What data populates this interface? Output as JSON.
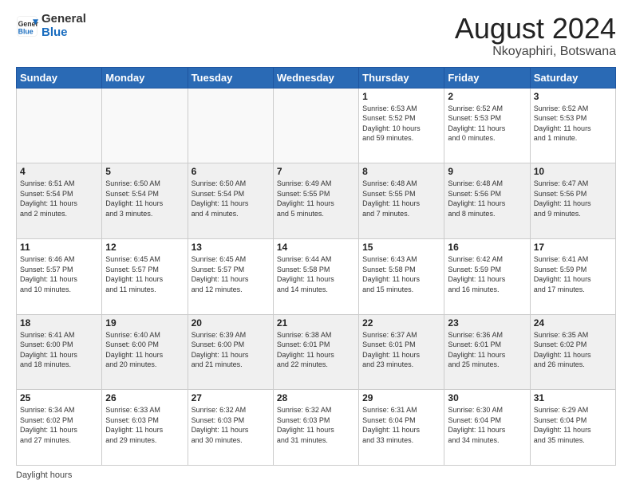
{
  "logo": {
    "general": "General",
    "blue": "Blue"
  },
  "header": {
    "title": "August 2024",
    "subtitle": "Nkoyaphiri, Botswana"
  },
  "weekdays": [
    "Sunday",
    "Monday",
    "Tuesday",
    "Wednesday",
    "Thursday",
    "Friday",
    "Saturday"
  ],
  "footer": {
    "daylight_label": "Daylight hours"
  },
  "weeks": [
    [
      {
        "day": "",
        "info": ""
      },
      {
        "day": "",
        "info": ""
      },
      {
        "day": "",
        "info": ""
      },
      {
        "day": "",
        "info": ""
      },
      {
        "day": "1",
        "info": "Sunrise: 6:53 AM\nSunset: 5:52 PM\nDaylight: 10 hours\nand 59 minutes."
      },
      {
        "day": "2",
        "info": "Sunrise: 6:52 AM\nSunset: 5:53 PM\nDaylight: 11 hours\nand 0 minutes."
      },
      {
        "day": "3",
        "info": "Sunrise: 6:52 AM\nSunset: 5:53 PM\nDaylight: 11 hours\nand 1 minute."
      }
    ],
    [
      {
        "day": "4",
        "info": "Sunrise: 6:51 AM\nSunset: 5:54 PM\nDaylight: 11 hours\nand 2 minutes."
      },
      {
        "day": "5",
        "info": "Sunrise: 6:50 AM\nSunset: 5:54 PM\nDaylight: 11 hours\nand 3 minutes."
      },
      {
        "day": "6",
        "info": "Sunrise: 6:50 AM\nSunset: 5:54 PM\nDaylight: 11 hours\nand 4 minutes."
      },
      {
        "day": "7",
        "info": "Sunrise: 6:49 AM\nSunset: 5:55 PM\nDaylight: 11 hours\nand 5 minutes."
      },
      {
        "day": "8",
        "info": "Sunrise: 6:48 AM\nSunset: 5:55 PM\nDaylight: 11 hours\nand 7 minutes."
      },
      {
        "day": "9",
        "info": "Sunrise: 6:48 AM\nSunset: 5:56 PM\nDaylight: 11 hours\nand 8 minutes."
      },
      {
        "day": "10",
        "info": "Sunrise: 6:47 AM\nSunset: 5:56 PM\nDaylight: 11 hours\nand 9 minutes."
      }
    ],
    [
      {
        "day": "11",
        "info": "Sunrise: 6:46 AM\nSunset: 5:57 PM\nDaylight: 11 hours\nand 10 minutes."
      },
      {
        "day": "12",
        "info": "Sunrise: 6:45 AM\nSunset: 5:57 PM\nDaylight: 11 hours\nand 11 minutes."
      },
      {
        "day": "13",
        "info": "Sunrise: 6:45 AM\nSunset: 5:57 PM\nDaylight: 11 hours\nand 12 minutes."
      },
      {
        "day": "14",
        "info": "Sunrise: 6:44 AM\nSunset: 5:58 PM\nDaylight: 11 hours\nand 14 minutes."
      },
      {
        "day": "15",
        "info": "Sunrise: 6:43 AM\nSunset: 5:58 PM\nDaylight: 11 hours\nand 15 minutes."
      },
      {
        "day": "16",
        "info": "Sunrise: 6:42 AM\nSunset: 5:59 PM\nDaylight: 11 hours\nand 16 minutes."
      },
      {
        "day": "17",
        "info": "Sunrise: 6:41 AM\nSunset: 5:59 PM\nDaylight: 11 hours\nand 17 minutes."
      }
    ],
    [
      {
        "day": "18",
        "info": "Sunrise: 6:41 AM\nSunset: 6:00 PM\nDaylight: 11 hours\nand 18 minutes."
      },
      {
        "day": "19",
        "info": "Sunrise: 6:40 AM\nSunset: 6:00 PM\nDaylight: 11 hours\nand 20 minutes."
      },
      {
        "day": "20",
        "info": "Sunrise: 6:39 AM\nSunset: 6:00 PM\nDaylight: 11 hours\nand 21 minutes."
      },
      {
        "day": "21",
        "info": "Sunrise: 6:38 AM\nSunset: 6:01 PM\nDaylight: 11 hours\nand 22 minutes."
      },
      {
        "day": "22",
        "info": "Sunrise: 6:37 AM\nSunset: 6:01 PM\nDaylight: 11 hours\nand 23 minutes."
      },
      {
        "day": "23",
        "info": "Sunrise: 6:36 AM\nSunset: 6:01 PM\nDaylight: 11 hours\nand 25 minutes."
      },
      {
        "day": "24",
        "info": "Sunrise: 6:35 AM\nSunset: 6:02 PM\nDaylight: 11 hours\nand 26 minutes."
      }
    ],
    [
      {
        "day": "25",
        "info": "Sunrise: 6:34 AM\nSunset: 6:02 PM\nDaylight: 11 hours\nand 27 minutes."
      },
      {
        "day": "26",
        "info": "Sunrise: 6:33 AM\nSunset: 6:03 PM\nDaylight: 11 hours\nand 29 minutes."
      },
      {
        "day": "27",
        "info": "Sunrise: 6:32 AM\nSunset: 6:03 PM\nDaylight: 11 hours\nand 30 minutes."
      },
      {
        "day": "28",
        "info": "Sunrise: 6:32 AM\nSunset: 6:03 PM\nDaylight: 11 hours\nand 31 minutes."
      },
      {
        "day": "29",
        "info": "Sunrise: 6:31 AM\nSunset: 6:04 PM\nDaylight: 11 hours\nand 33 minutes."
      },
      {
        "day": "30",
        "info": "Sunrise: 6:30 AM\nSunset: 6:04 PM\nDaylight: 11 hours\nand 34 minutes."
      },
      {
        "day": "31",
        "info": "Sunrise: 6:29 AM\nSunset: 6:04 PM\nDaylight: 11 hours\nand 35 minutes."
      }
    ]
  ]
}
